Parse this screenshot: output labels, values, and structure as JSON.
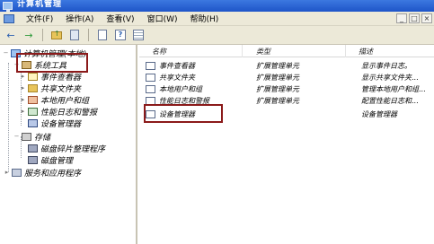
{
  "window": {
    "title": "计算机管理"
  },
  "menu": {
    "items": [
      "文件(F)",
      "操作(A)",
      "查看(V)",
      "窗口(W)",
      "帮助(H)"
    ],
    "controls": {
      "minimize": "_",
      "restore": "□",
      "close": "×"
    }
  },
  "toolbar": {
    "back_icon": "←",
    "forward_icon": "→"
  },
  "tree": {
    "root": "计算机管理(本地)",
    "system_tools": "系统工具",
    "items": [
      "事件查看器",
      "共享文件夹",
      "本地用户和组",
      "性能日志和警报",
      "设备管理器"
    ],
    "storage": "存储",
    "storage_items": [
      "磁盘碎片整理程序",
      "磁盘管理"
    ],
    "services": "服务和应用程序"
  },
  "list": {
    "columns": {
      "name": "名称",
      "type": "类型",
      "desc": "描述"
    },
    "rows": [
      {
        "name": "事件查看器",
        "type": "扩展管理单元",
        "desc": "显示事件日志。"
      },
      {
        "name": "共享文件夹",
        "type": "扩展管理单元",
        "desc": "显示共享文件夹..."
      },
      {
        "name": "本地用户和组",
        "type": "扩展管理单元",
        "desc": "管理本地用户和组..."
      },
      {
        "name": "性能日志和警报",
        "type": "扩展管理单元",
        "desc": "配置性能日志和..."
      },
      {
        "name": "设备管理器",
        "type": "",
        "desc": "设备管理器"
      }
    ]
  }
}
